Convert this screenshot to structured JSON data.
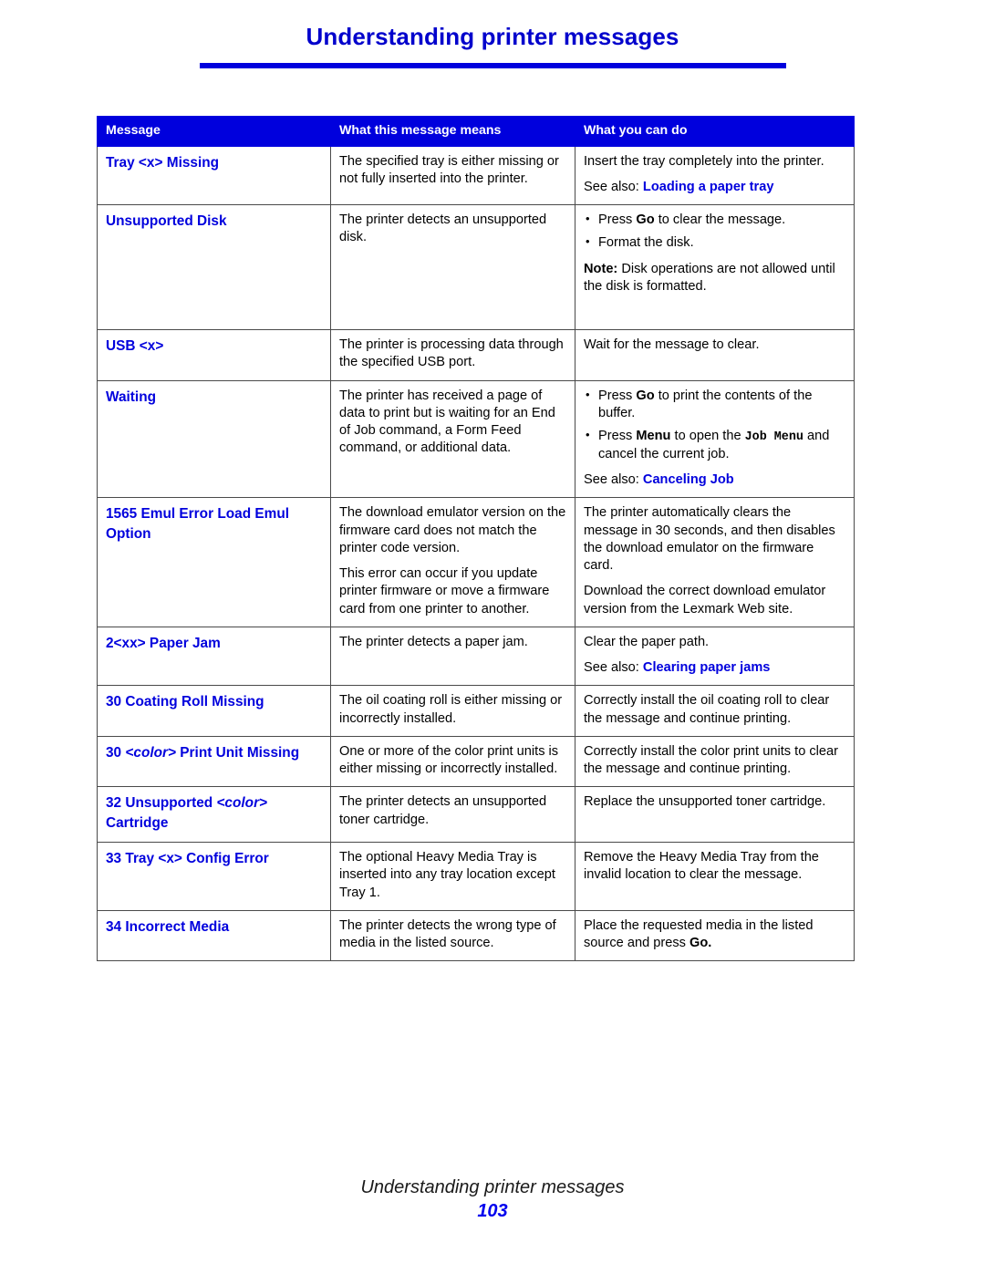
{
  "header": {
    "title": "Understanding printer messages"
  },
  "table": {
    "columns": [
      "Message",
      "What this message means",
      "What you can do"
    ],
    "rows": [
      {
        "message": "Tray <x> Missing",
        "means": "The specified tray is either missing or not fully inserted into the printer.",
        "do_text": "Insert the tray completely into the printer.",
        "see_also_label": "See also: ",
        "see_also_link": "Loading a paper tray"
      },
      {
        "message": "Unsupported Disk",
        "means": "The printer detects an unsupported disk.",
        "bullets": [
          "Press Go to clear the message.",
          "Format the disk."
        ],
        "note_label": "Note:",
        "note_text": " Disk operations are not allowed until the disk is formatted."
      },
      {
        "message": "USB <x>",
        "means": "The printer is processing data through the specified USB port.",
        "do_text": "Wait for the message to clear."
      },
      {
        "message": "Waiting",
        "means": "The printer has received a page of data to print but is waiting for an End of Job command, a Form Feed command, or additional data.",
        "bullet1_a": "Press ",
        "bullet1_b": "Go",
        "bullet1_c": " to print the contents of the buffer.",
        "bullet2_a": "Press ",
        "bullet2_b": "Menu",
        "bullet2_c": " to open the ",
        "bullet2_mono": "Job Menu",
        "bullet2_d": " and cancel the current job.",
        "see_also_label": "See also: ",
        "see_also_link": "Canceling Job"
      },
      {
        "message": "1565 Emul Error Load Emul Option",
        "means_p1": "The download emulator version on the firmware card does not match the printer code version.",
        "means_p2": "This error can occur if you update printer firmware or move a firmware card from one printer to another.",
        "do_p1": "The printer automatically clears the message in 30 seconds, and then disables the download emulator on the firmware card.",
        "do_p2": "Download the correct download emulator version from the Lexmark Web site."
      },
      {
        "message": "2<xx> Paper Jam",
        "means": "The printer detects a paper jam.",
        "do_text": "Clear the paper path.",
        "see_also_label": "See also: ",
        "see_also_link": "Clearing paper jams"
      },
      {
        "message": "30 Coating Roll Missing",
        "means": "The oil coating roll is either missing or incorrectly installed.",
        "do_text": "Correctly install the oil coating roll to clear the message and continue printing."
      },
      {
        "message_a": "30 ",
        "message_italic": "<color>",
        "message_b": " Print Unit Missing",
        "means": "One or more of the color print units is either missing or incorrectly installed.",
        "do_text": "Correctly install the color print units to clear the message and continue printing."
      },
      {
        "message_a": "32 Unsupported ",
        "message_italic": "<color>",
        "message_b": " Cartridge",
        "means": "The printer detects an unsupported toner cartridge.",
        "do_text": "Replace the unsupported toner cartridge."
      },
      {
        "message": "33 Tray <x> Config Error",
        "means": "The optional Heavy Media Tray is inserted into any tray location except Tray 1.",
        "do_text": "Remove the Heavy Media Tray from the invalid location to clear the message."
      },
      {
        "message": "34 Incorrect Media",
        "means": "The printer detects the wrong type of media in the listed source.",
        "do_a": "Place the requested media in the listed source and press ",
        "do_b": "Go."
      }
    ]
  },
  "footer": {
    "title": "Understanding printer messages",
    "page_number": "103"
  },
  "colors": {
    "accent_blue": "#0000dd",
    "header_bg": "#0000dd",
    "border": "#4a4a4a"
  }
}
